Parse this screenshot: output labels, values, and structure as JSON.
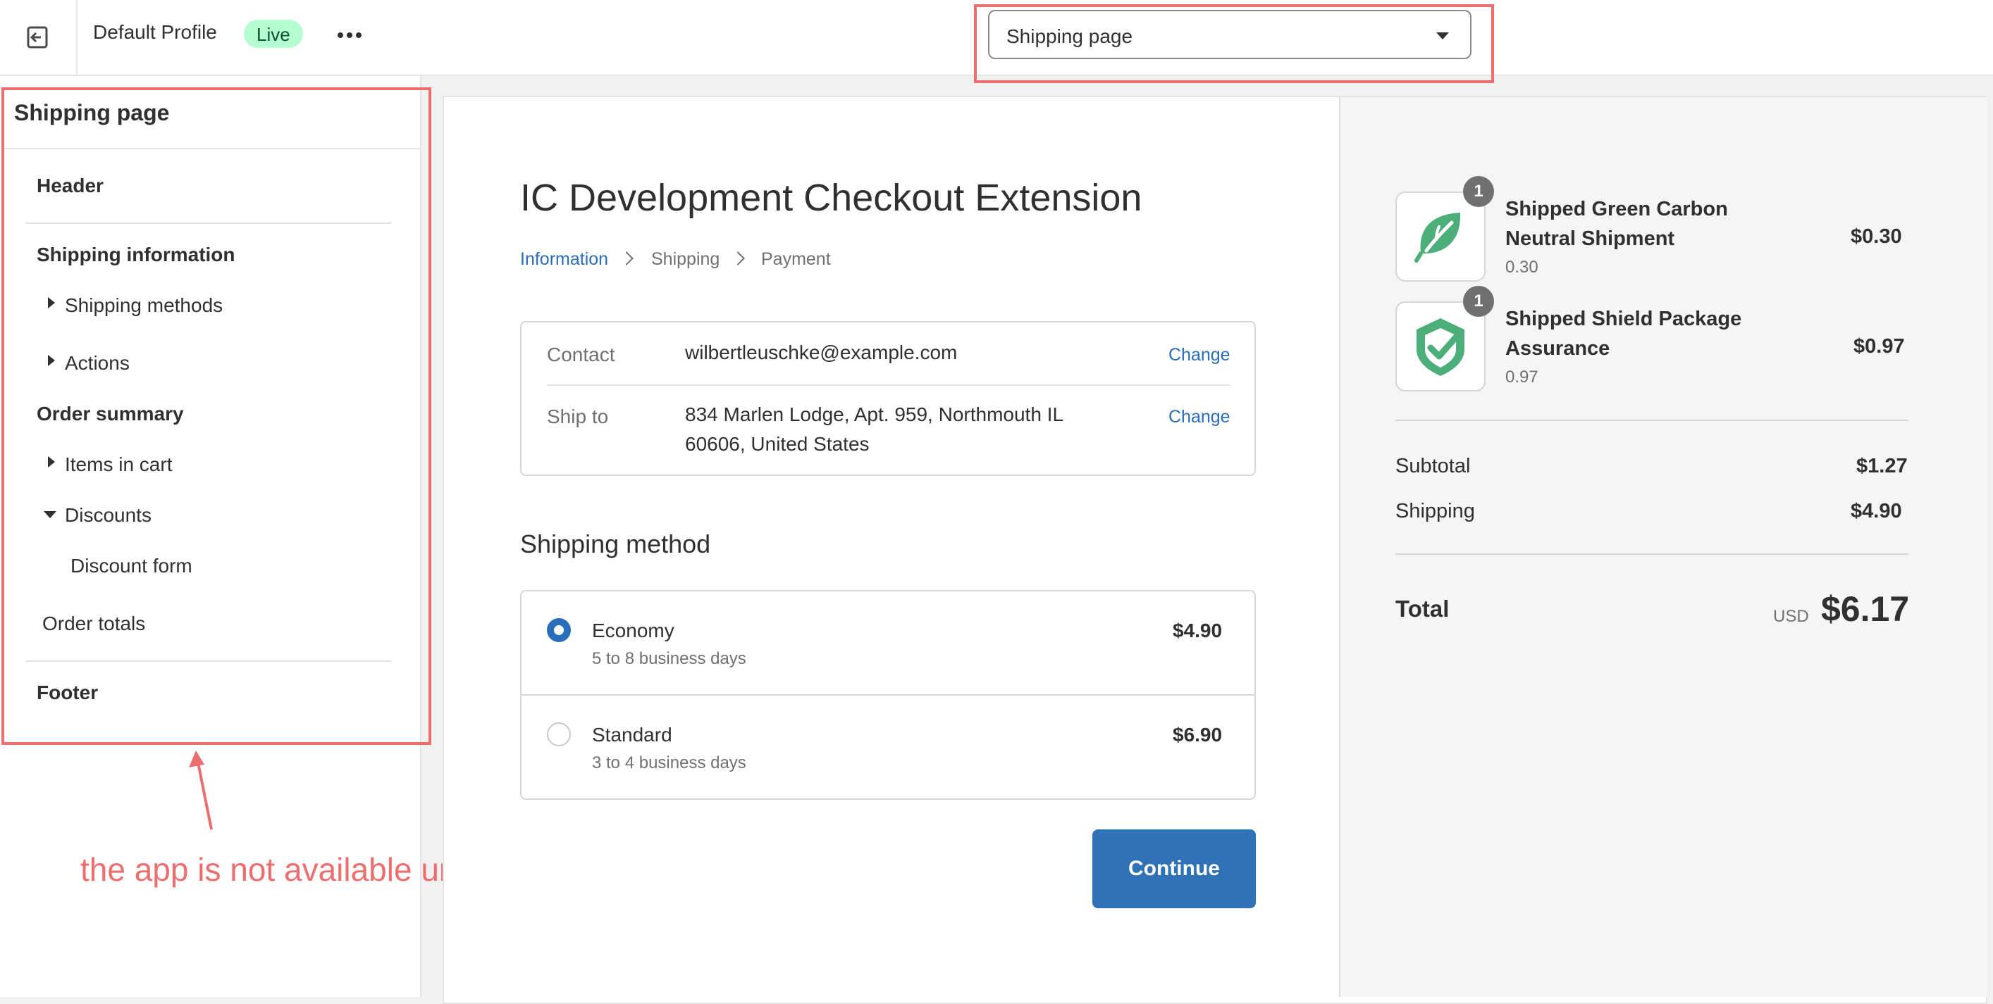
{
  "topbar": {
    "profile_name": "Default Profile",
    "live_badge": "Live",
    "page_select_value": "Shipping page"
  },
  "sidebar": {
    "title": "Shipping page",
    "items": [
      {
        "label": "Header"
      },
      {
        "label": "Shipping information"
      },
      {
        "label": "Shipping methods"
      },
      {
        "label": "Actions"
      },
      {
        "label": "Order summary"
      },
      {
        "label": "Items in cart"
      },
      {
        "label": "Discounts"
      },
      {
        "label": "Discount form"
      },
      {
        "label": "Order totals"
      },
      {
        "label": "Footer"
      }
    ]
  },
  "annotation": {
    "text": "the app is not available under Shipping page",
    "color": "#ec6e6e"
  },
  "checkout": {
    "title": "IC Development Checkout Extension",
    "breadcrumb": [
      "Information",
      "Shipping",
      "Payment"
    ],
    "contact_label": "Contact",
    "contact_value": "wilbertleuschke@example.com",
    "ship_to_label": "Ship to",
    "ship_to_line1": "834 Marlen Lodge, Apt. 959, Northmouth IL",
    "ship_to_line2": "60606, United States",
    "change_label": "Change",
    "shipping_method_heading": "Shipping method",
    "methods": [
      {
        "name": "Economy",
        "detail": "5 to 8 business days",
        "price": "$4.90",
        "selected": true
      },
      {
        "name": "Standard",
        "detail": "3 to 4 business days",
        "price": "$6.90",
        "selected": false
      }
    ],
    "continue_label": "Continue",
    "accent_color": "#2f72b7"
  },
  "summary": {
    "products": [
      {
        "name_line1": "Shipped Green Carbon",
        "name_line2": "Neutral Shipment",
        "sub": "0.30",
        "price": "$0.30",
        "qty": "1",
        "icon": "leaf-icon"
      },
      {
        "name_line1": "Shipped Shield Package",
        "name_line2": "Assurance",
        "sub": "0.97",
        "price": "$0.97",
        "qty": "1",
        "icon": "shield-check-icon"
      }
    ],
    "subtotal_label": "Subtotal",
    "subtotal_value": "$1.27",
    "shipping_label": "Shipping",
    "shipping_value": "$4.90",
    "total_label": "Total",
    "currency": "USD",
    "total_value": "$6.17"
  }
}
